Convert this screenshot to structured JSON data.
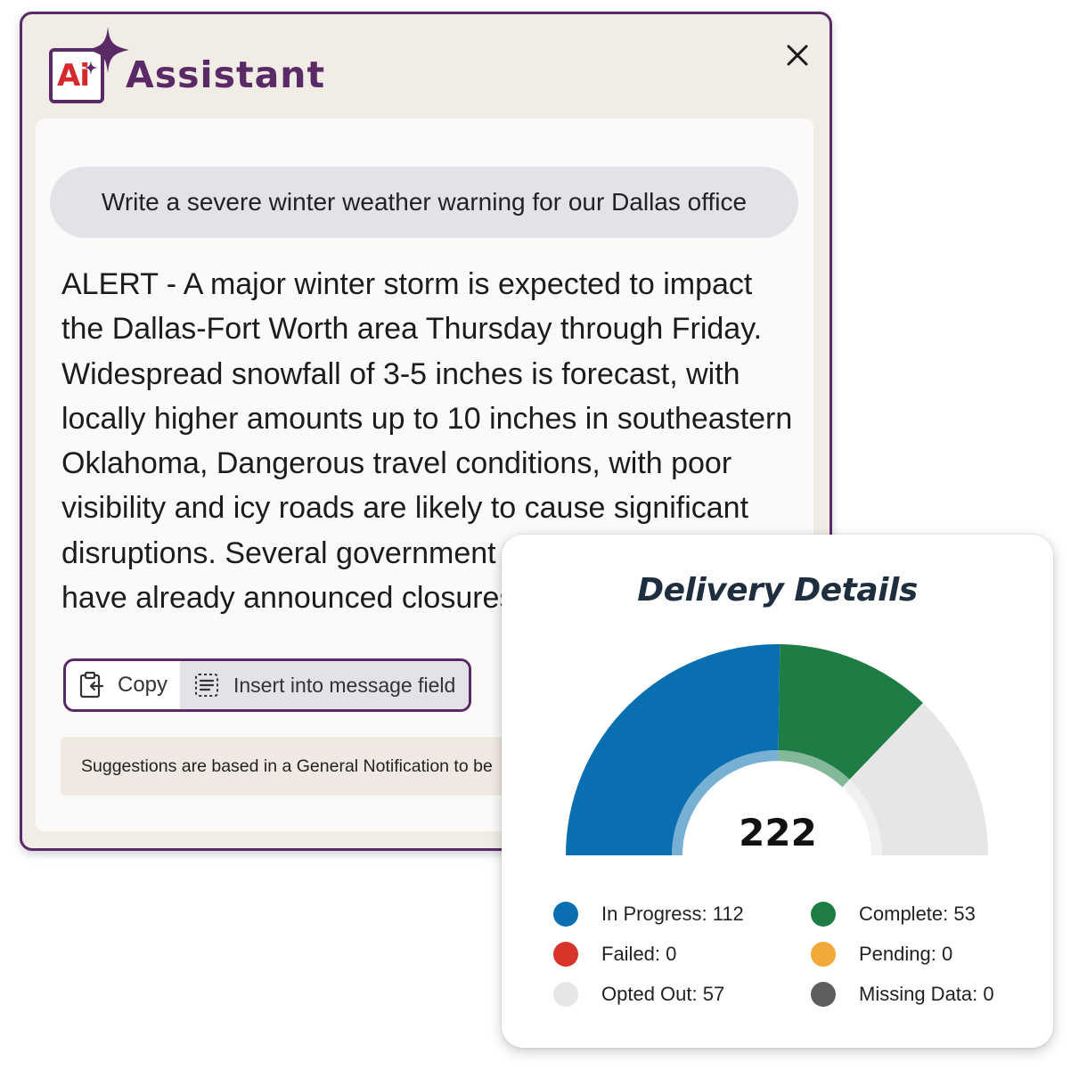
{
  "assistant": {
    "logo_text": "Ai",
    "title": "Assistant",
    "prompt": "Write a severe winter weather warning for our Dallas office",
    "response_lines": [
      "ALERT - A major winter storm is expected to impact",
      "the Dallas-Fort Worth area Thursday through Friday.",
      "Widespread snowfall of 3-5 inches is forecast, with",
      "locally higher amounts up to 10 inches in southeastern",
      "Oklahoma, Dangerous travel conditions, with poor",
      "visibility and icy roads are likely to cause significant",
      "disruptions. Several government",
      "have already announced closures"
    ],
    "copy_label": "Copy",
    "insert_label": "Insert into message field",
    "note": "Suggestions are based in a General Notification to be"
  },
  "delivery": {
    "title": "Delivery Details",
    "total": "222",
    "legend": [
      {
        "key": "in_progress",
        "label": "In Progress: 112",
        "color": "#0a6fb0"
      },
      {
        "key": "complete",
        "label": "Complete: 53",
        "color": "#1e7d44"
      },
      {
        "key": "failed",
        "label": "Failed: 0",
        "color": "#d8352a"
      },
      {
        "key": "pending",
        "label": "Pending: 0",
        "color": "#f2a93b"
      },
      {
        "key": "opted_out",
        "label": "Opted Out: 57",
        "color": "#e6e6e6"
      },
      {
        "key": "missing",
        "label": "Missing Data: 0",
        "color": "#5e5e5e"
      }
    ]
  },
  "chart_data": {
    "type": "pie",
    "title": "Delivery Details",
    "total": 222,
    "categories": [
      "In Progress",
      "Complete",
      "Failed",
      "Pending",
      "Opted Out",
      "Missing Data"
    ],
    "values": [
      112,
      53,
      0,
      0,
      57,
      0
    ],
    "colors": [
      "#0a6fb0",
      "#1e7d44",
      "#d8352a",
      "#f2a93b",
      "#e6e6e6",
      "#5e5e5e"
    ]
  }
}
